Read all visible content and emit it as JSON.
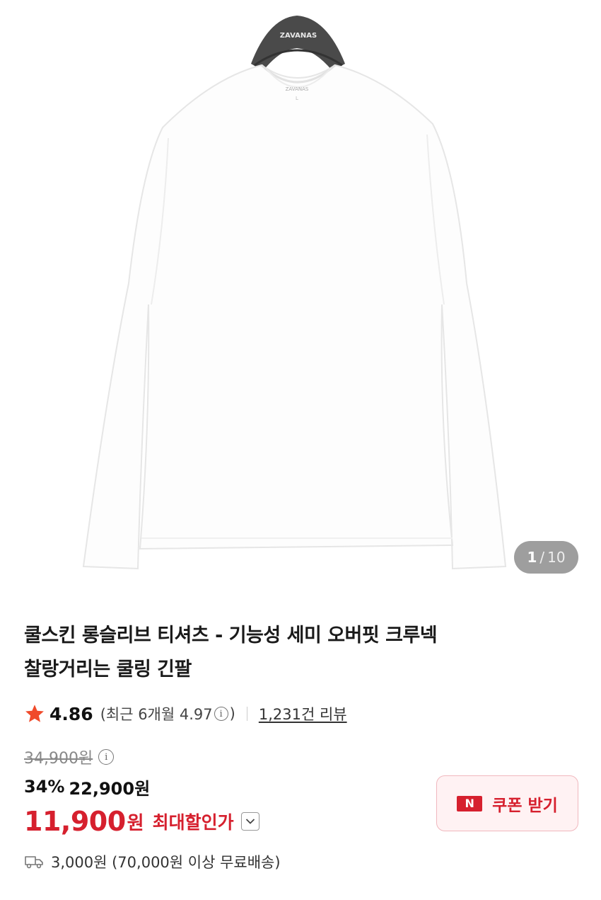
{
  "gallery": {
    "current": "1",
    "separator": "/",
    "total": "10",
    "brand_tag": "ZAVANAS",
    "neck_label": "ZAVANAS",
    "size_label": "L"
  },
  "product": {
    "title_line1": "쿨스킨 롱슬리브 티셔츠 - 기능성 세미 오버핏 크루넥",
    "title_line2": "찰랑거리는 쿨링 긴팔"
  },
  "rating": {
    "score": "4.86",
    "recent_open": "(최근 6개월 4.97",
    "recent_close": ")",
    "reviews_link": "1,231건 리뷰"
  },
  "price": {
    "original": "34,900원",
    "discount_rate": "34%",
    "sale_price": "22,900원",
    "max_price": "11,900",
    "max_won": "원",
    "max_label": "최대할인가"
  },
  "coupon": {
    "badge": "N",
    "label": "쿠폰 받기"
  },
  "shipping": {
    "text": "3,000원 (70,000원 이상 무료배송)"
  },
  "colors": {
    "accent_red": "#d6202e",
    "star": "#f04a2a"
  }
}
